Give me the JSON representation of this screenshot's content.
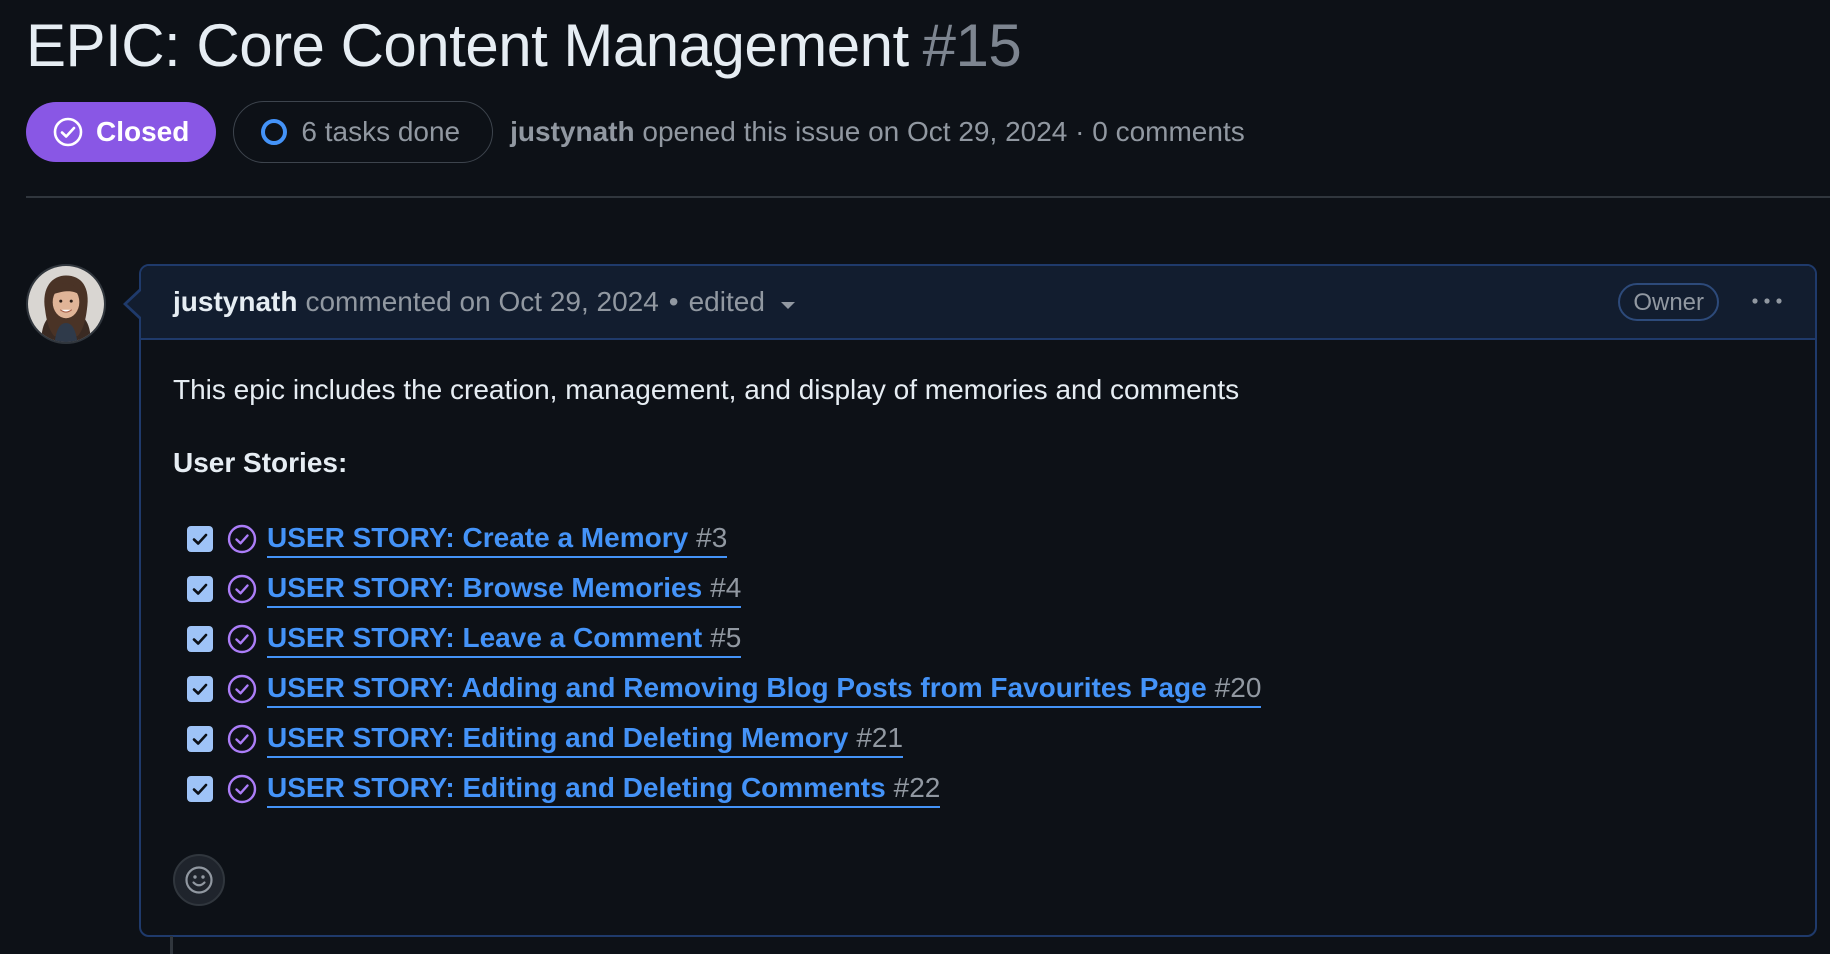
{
  "issue": {
    "title": "EPIC: Core Content Management",
    "number": "#15",
    "state": "Closed",
    "tasks_done": "6 tasks done",
    "author": "justynath",
    "opened_text": "opened this issue on Oct 29, 2024 · 0 comments"
  },
  "comment": {
    "author": "justynath",
    "action": "commented on Oct 29, 2024",
    "separator": "•",
    "edited": "edited",
    "role_badge": "Owner",
    "intro": "This epic includes the creation, management, and display of memories and comments",
    "stories_heading": "User Stories:",
    "tasks": [
      {
        "title": "USER STORY: Create a Memory",
        "number": "#3",
        "checked": true
      },
      {
        "title": "USER STORY: Browse Memories",
        "number": "#4",
        "checked": true
      },
      {
        "title": "USER STORY: Leave a Comment",
        "number": "#5",
        "checked": true
      },
      {
        "title": "USER STORY: Adding and Removing Blog Posts from Favourites Page",
        "number": "#20",
        "checked": true
      },
      {
        "title": "USER STORY: Editing and Deleting Memory",
        "number": "#21",
        "checked": true
      },
      {
        "title": "USER STORY: Editing and Deleting Comments",
        "number": "#22",
        "checked": true
      }
    ]
  },
  "icons": {
    "state": "check-circle-icon",
    "tasks": "progress-ring-icon",
    "task_done": "check-circle-icon",
    "more": "kebab-horizontal-icon",
    "reaction": "smiley-icon",
    "dropdown": "triangle-down-icon"
  },
  "colors": {
    "background": "#0d1117",
    "closed_badge": "#8957e5",
    "link": "#4493f8",
    "muted": "#9198a1",
    "comment_header": "#121d2f",
    "comment_border": "#1f3a6b"
  }
}
